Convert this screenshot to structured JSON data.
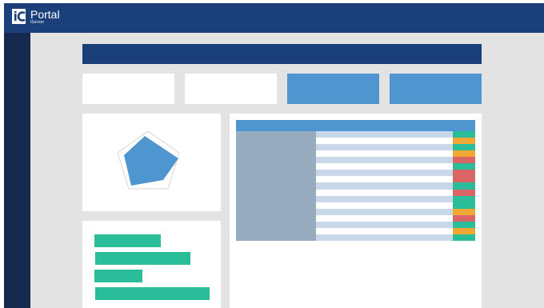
{
  "header": {
    "logo_initials": "iC",
    "app_title": "Portal",
    "app_subtitle": "iServer",
    "background": "#1b3f79"
  },
  "sidebar": {
    "background": "#15284e"
  },
  "page": {
    "background": "#e3e3e3",
    "title_bar_color": "#1b3f79"
  },
  "cards": [
    {
      "name": "summary-card-1",
      "color": "#ffffff"
    },
    {
      "name": "summary-card-2",
      "color": "#ffffff"
    },
    {
      "name": "summary-card-3",
      "color": "#4f96d1"
    },
    {
      "name": "summary-card-4",
      "color": "#4f96d1"
    }
  ],
  "radar_chart": {
    "axis_count": 5,
    "grid_color": "#d6d6d6",
    "fill_color": "#4f96d1"
  },
  "bar_panel": {
    "bar_color": "#2abd9a",
    "bars": [
      0.58,
      0.83,
      0.41,
      1.0
    ]
  },
  "table": {
    "header_color": "#4f96d1",
    "side_color": "#97adbf",
    "row_colors": [
      "#c9d8e8",
      "#ffffff"
    ],
    "row_count": 17,
    "status_colors": [
      "#2abd9a",
      "#f0a733",
      "#2abd9a",
      "#f0a733",
      "#d96567",
      "#2abd9a",
      "#d96567",
      "#d96567",
      "#2abd9a",
      "#d96567",
      "#2abd9a",
      "#2abd9a",
      "#f0a733",
      "#d96567",
      "#2abd9a",
      "#f0a733",
      "#2abd9a"
    ]
  }
}
